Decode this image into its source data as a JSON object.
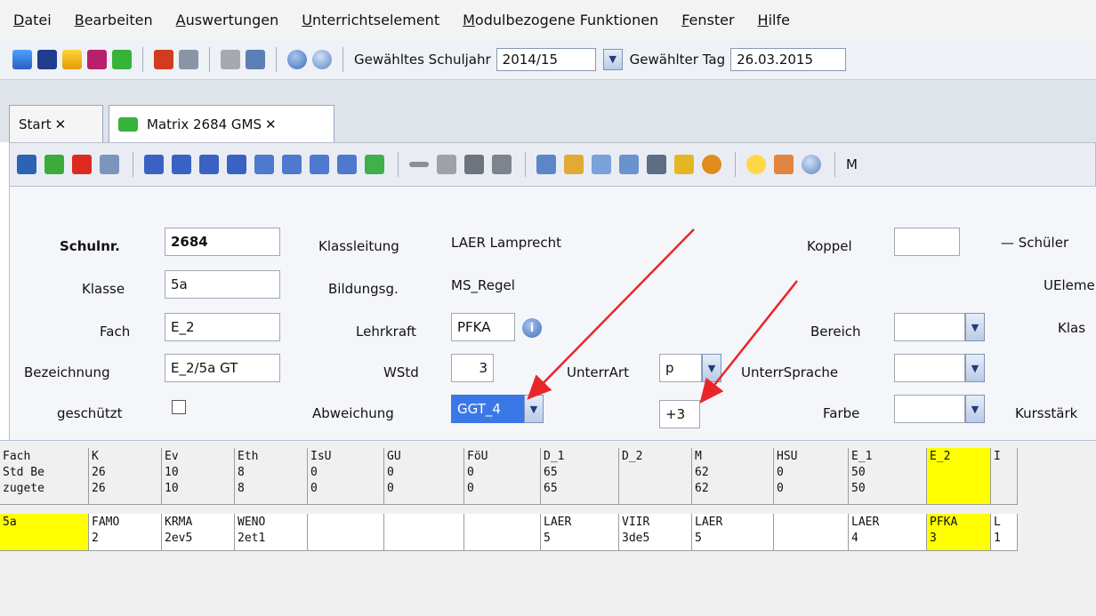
{
  "menu": [
    "Datei",
    "Bearbeiten",
    "Auswertungen",
    "Unterrichtselement",
    "Modulbezogene Funktionen",
    "Fenster",
    "Hilfe"
  ],
  "toolbar1": {
    "schuljahr_label": "Gewähltes Schuljahr",
    "schuljahr_value": "2014/15",
    "tag_label": "Gewählter Tag",
    "tag_value": "26.03.2015"
  },
  "tabs": [
    {
      "label": "Start"
    },
    {
      "label": "Matrix 2684 GMS"
    }
  ],
  "tab_close": "✕",
  "toolbar2_more": "M",
  "form": {
    "schulnr_label": "Schulnr.",
    "schulnr_value": "2684",
    "klasse_label": "Klasse",
    "klasse_value": "5a",
    "fach_label": "Fach",
    "fach_value": "E_2",
    "bezeichnung_label": "Bezeichnung",
    "bezeichnung_value": "E_2/5a GT",
    "geschuetzt_label": "geschützt",
    "klassleitung_label": "Klassleitung",
    "klassleitung_value": "LAER Lamprecht",
    "bildungsg_label": "Bildungsg.",
    "bildungsg_value": "MS_Regel",
    "lehrkraft_label": "Lehrkraft",
    "lehrkraft_value": "PFKA",
    "wstd_label": "WStd",
    "wstd_value": "3",
    "abweichung_label": "Abweichung",
    "abweichung_value": "GGT_4",
    "unterrart_label": "UnterrArt",
    "unterrart_value": "p",
    "abweichung_delta": "+3",
    "koppel_label": "Koppel",
    "bereich_label": "Bereich",
    "unterrsprache_label": "UnterrSprache",
    "farbe_label": "Farbe",
    "schueler_label": "— Schüler",
    "uelem_label": "UEleme",
    "klas_label": "Klas",
    "kursstaerke_label": "Kursstärk"
  },
  "grid": {
    "row_labels": [
      "Fach",
      "Std Be",
      "zugete"
    ],
    "columns": [
      {
        "fach": "K",
        "std": "26",
        "zug": "26"
      },
      {
        "fach": "Ev",
        "std": "10",
        "zug": "10"
      },
      {
        "fach": "Eth",
        "std": "8",
        "zug": "8"
      },
      {
        "fach": "IsU",
        "std": "0",
        "zug": "0"
      },
      {
        "fach": "GU",
        "std": "0",
        "zug": "0"
      },
      {
        "fach": "FöU",
        "std": "0",
        "zug": "0"
      },
      {
        "fach": "D_1",
        "std": "65",
        "zug": "65"
      },
      {
        "fach": "D_2",
        "std": "",
        "zug": ""
      },
      {
        "fach": "M",
        "std": "62",
        "zug": "62"
      },
      {
        "fach": "HSU",
        "std": "0",
        "zug": "0"
      },
      {
        "fach": "E_1",
        "std": "50",
        "zug": "50"
      },
      {
        "fach": "E_2",
        "std": "",
        "zug": ""
      },
      {
        "fach": "I",
        "std": "",
        "zug": ""
      }
    ],
    "class_row_label": "5a",
    "class_row": [
      {
        "a": "FAMO",
        "b": "2"
      },
      {
        "a": "KRMA",
        "b": "2ev5"
      },
      {
        "a": "WENO",
        "b": "2et1"
      },
      {
        "a": "",
        "b": ""
      },
      {
        "a": "",
        "b": ""
      },
      {
        "a": "",
        "b": ""
      },
      {
        "a": "LAER",
        "b": "5"
      },
      {
        "a": "VIIR",
        "b": "3de5"
      },
      {
        "a": "LAER",
        "b": "5"
      },
      {
        "a": "",
        "b": ""
      },
      {
        "a": "LAER",
        "b": "4"
      },
      {
        "a": "PFKA",
        "b": "3"
      },
      {
        "a": "L",
        "b": "1"
      }
    ]
  },
  "colors": {
    "highlight": "#ffff00",
    "selection": "#3b78e7",
    "arrow": "#e8262a"
  }
}
